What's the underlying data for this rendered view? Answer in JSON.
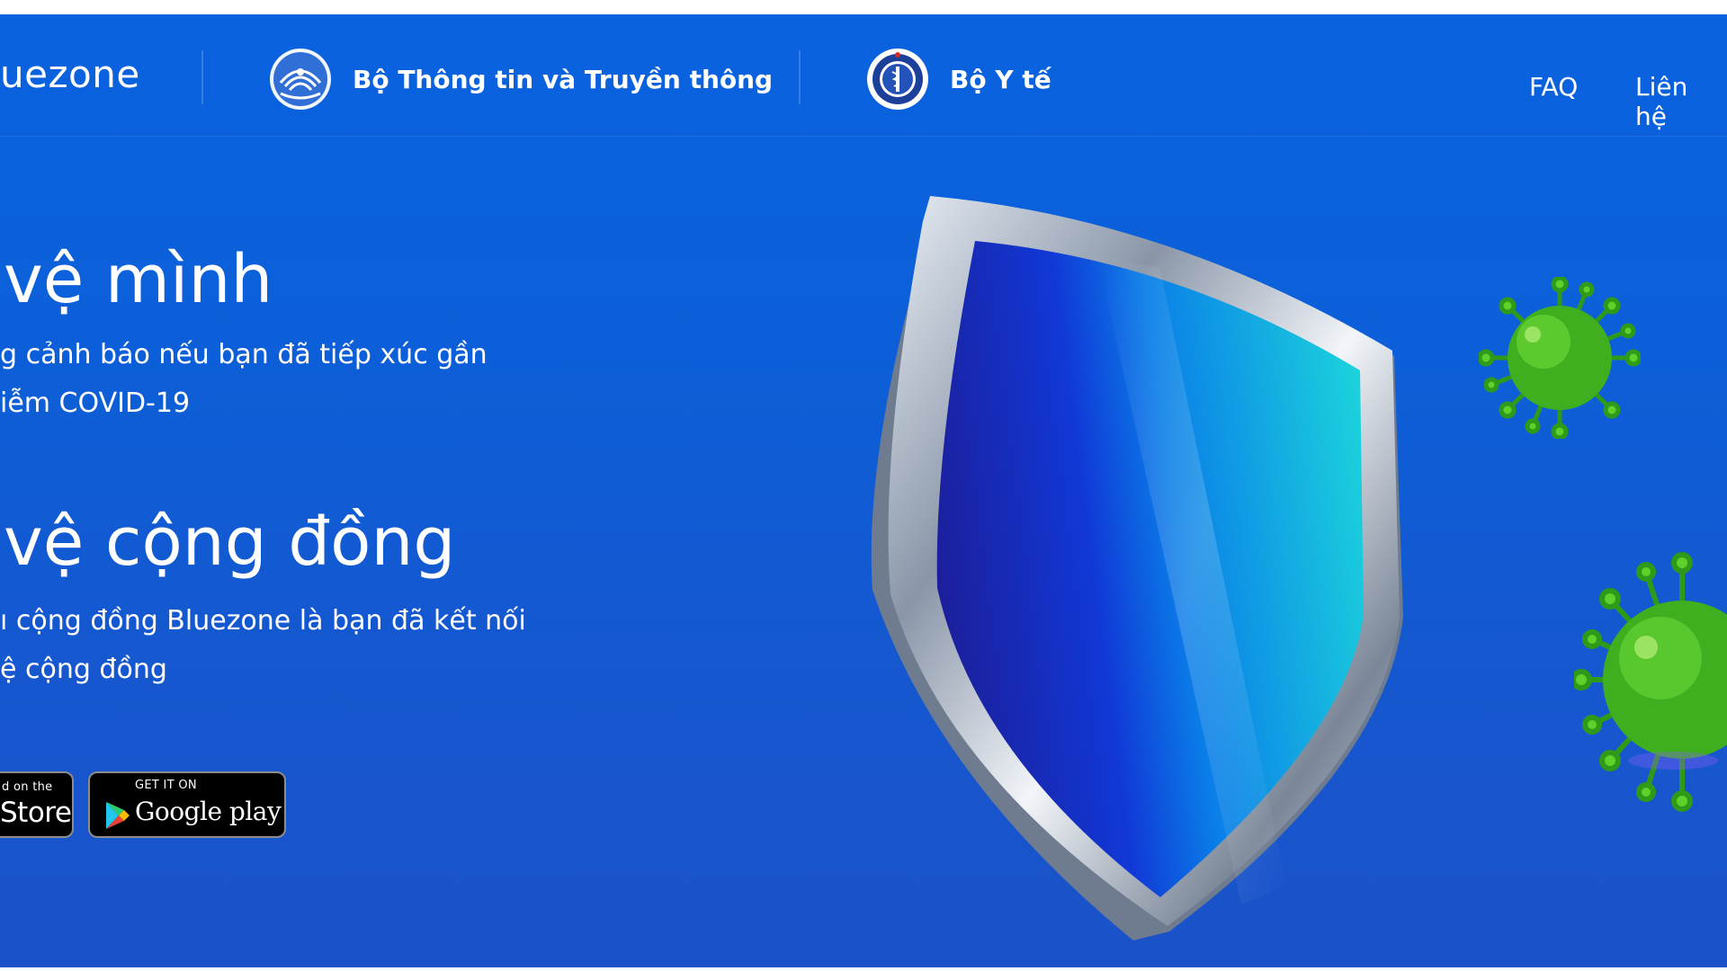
{
  "brand": {
    "name": "uezone"
  },
  "nav": {
    "org1_label": "Bộ Thông tin và Truyền thông",
    "org2_label": "Bộ Y tế",
    "faq_label": "FAQ",
    "contact_label": "Liên hệ"
  },
  "hero": {
    "heading1": "vệ mình",
    "sub1_line1": "g cảnh báo nếu bạn đã tiếp xúc gần",
    "sub1_line2": "iễm COVID-19",
    "heading2": "vệ cộng đồng",
    "sub2_line1": "ı cộng đồng Bluezone là bạn đã kết nối",
    "sub2_line2": "ệ cộng đồng"
  },
  "store": {
    "appstore_small": "d on the",
    "appstore_big": "Store",
    "googleplay_small": "GET IT ON",
    "googleplay_big": "Google play"
  },
  "colors": {
    "background_top": "#0a62df",
    "background_bottom": "#1a52c9",
    "text": "#ffffff",
    "virus": "#3fae1f"
  },
  "icons": [
    "ministry-info-emblem-icon",
    "ministry-health-emblem-icon",
    "shield-icon",
    "virus-icon",
    "play-triangle-icon"
  ]
}
